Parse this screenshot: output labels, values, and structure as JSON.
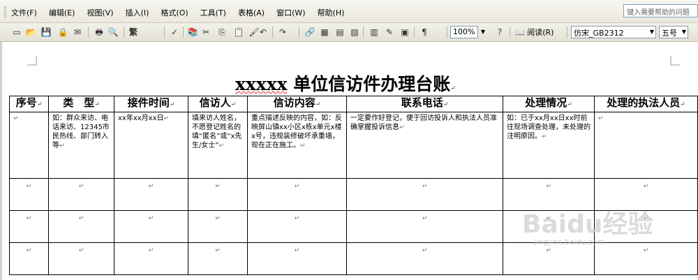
{
  "menubar": {
    "items": [
      "文件(F)",
      "编辑(E)",
      "视图(V)",
      "插入(I)",
      "格式(O)",
      "工具(T)",
      "表格(A)",
      "窗口(W)",
      "帮助(H)"
    ],
    "help_placeholder": "键入需要帮助的问题"
  },
  "toolbar": {
    "traditional": "繁",
    "zoom": "100%",
    "read_label": "阅读(R)",
    "font": "仿宋_GB2312",
    "font_size": "五号",
    "icons": [
      "new-icon",
      "open-icon",
      "save-icon",
      "permission-icon",
      "email-icon",
      "print-icon",
      "print-preview-icon",
      "spelling-icon",
      "research-icon",
      "cut-icon",
      "copy-icon",
      "paste-icon",
      "format-painter-icon",
      "undo-icon",
      "redo-icon",
      "hyperlink-icon",
      "tables-borders-icon",
      "insert-table-icon",
      "insert-excel-icon",
      "columns-icon",
      "drawing-icon",
      "document-map-icon",
      "show-hide-icon",
      "help-icon"
    ]
  },
  "document": {
    "title_prefix": "xxxxx",
    "title_rest": " 单位信访件办理台账",
    "headers": [
      "序号",
      "类　型",
      "接件时间",
      "信访人",
      "信访内容",
      "联系电话",
      "处理情况",
      "处理的执法人员"
    ],
    "row1": [
      "",
      "如：群众来访、电话来访、12345市民热线、部门转入等",
      "xx年xx月xx日",
      "填来访人姓名，不愿登记姓名的填“匿名”或“x先生/女士”",
      "重点描述反映的内容，如：反映屏山镇xx小区x栋x单元x楼x号，违规装修破坏承重墙，现在正在施工。",
      "一定要作好登记，便于回访投诉人和执法人员准确掌握投诉信息",
      "如：已于xx月xx日xx时前往现场调查处理，未处理的注明原因。",
      ""
    ],
    "empty_rows": 3,
    "paragraph_mark": "↵"
  },
  "watermark": {
    "brand": "Baidu经验",
    "url": "jingyan.baidu.com"
  }
}
